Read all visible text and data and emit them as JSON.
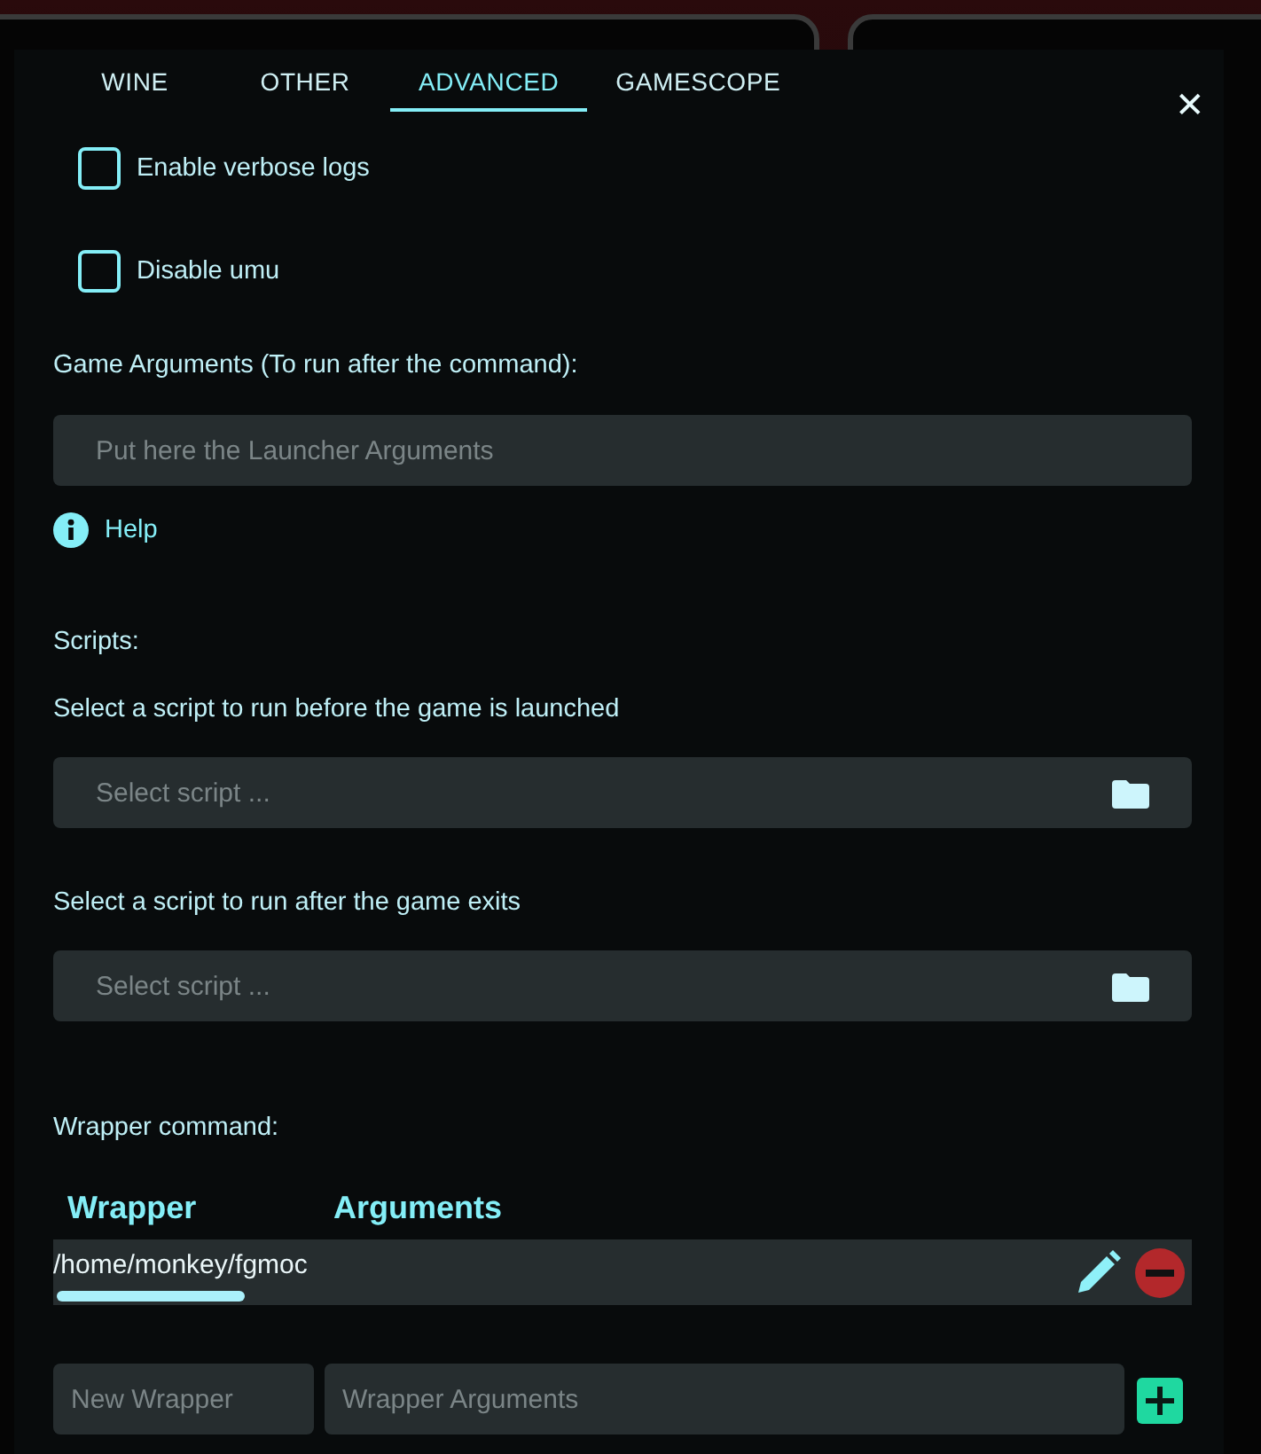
{
  "tabs": [
    {
      "label": "WINE",
      "selected": false
    },
    {
      "label": "OTHER",
      "selected": false
    },
    {
      "label": "ADVANCED",
      "selected": true
    },
    {
      "label": "GAMESCOPE",
      "selected": false
    }
  ],
  "close_button": "✕",
  "checkboxes": [
    {
      "label": "Enable verbose logs",
      "checked": false
    },
    {
      "label": "Disable umu",
      "checked": false
    }
  ],
  "game_arguments": {
    "label": "Game Arguments (To run after the command):",
    "placeholder": "Put here the Launcher Arguments",
    "help": "Help"
  },
  "scripts": {
    "title": "Scripts:",
    "items": [
      {
        "label": "Select a script to run before the game is launched",
        "placeholder": "Select script ..."
      },
      {
        "label": "Select a script to run after the game exits",
        "placeholder": "Select script ..."
      }
    ]
  },
  "wrapper": {
    "title": "Wrapper command:",
    "columns": [
      "Wrapper",
      "Arguments"
    ],
    "rows": [
      {
        "wrapper": "/home/monkey/fgmoc"
      }
    ],
    "new_wrapper_placeholder": "New Wrapper",
    "arguments_placeholder": "Wrapper Arguments"
  }
}
